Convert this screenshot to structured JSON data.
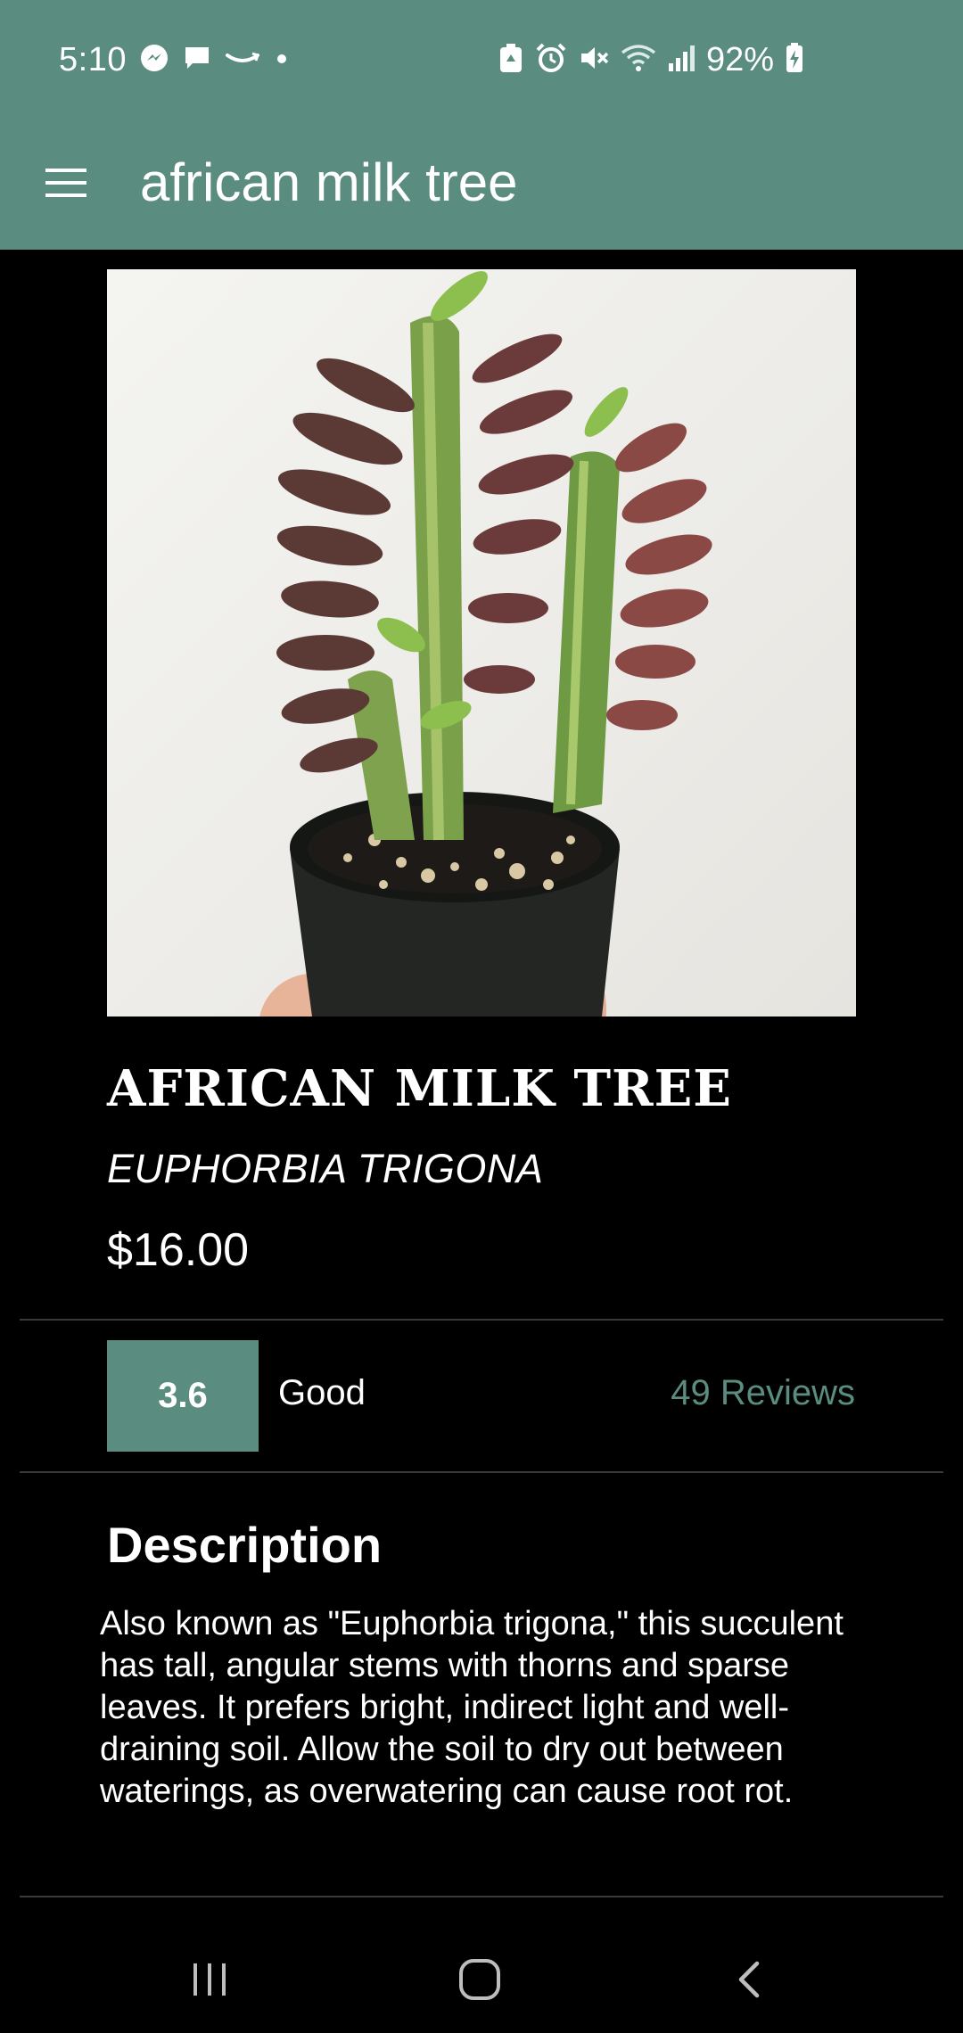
{
  "status_bar": {
    "time": "5:10",
    "battery_percent": "92%",
    "left_icons": [
      "messenger-icon",
      "chat-icon",
      "amazon-icon",
      "dot-icon"
    ],
    "right_icons": [
      "recycle-icon",
      "alarm-icon",
      "mute-icon",
      "wifi-icon",
      "signal-icon",
      "battery-charging-icon"
    ]
  },
  "app_bar": {
    "title": "african milk tree",
    "menu_icon": "hamburger-menu-icon",
    "color": "#5a8c80"
  },
  "product": {
    "name": "AFRICAN MILK TREE",
    "scientific_name": "EUPHORBIA TRIGONA",
    "price": "$16.00"
  },
  "rating": {
    "score": "3.6",
    "label": "Good",
    "reviews": "49 Reviews"
  },
  "description": {
    "heading": "Description",
    "body": "Also known as \"Euphorbia trigona,\" this succulent has tall, angular stems with thorns and sparse leaves. It prefers bright, indirect light and well-draining soil. Allow the soil to dry out between waterings, as overwatering can cause root rot."
  },
  "nav_bar": {
    "buttons": [
      "recent-apps-icon",
      "home-icon",
      "back-icon"
    ]
  }
}
